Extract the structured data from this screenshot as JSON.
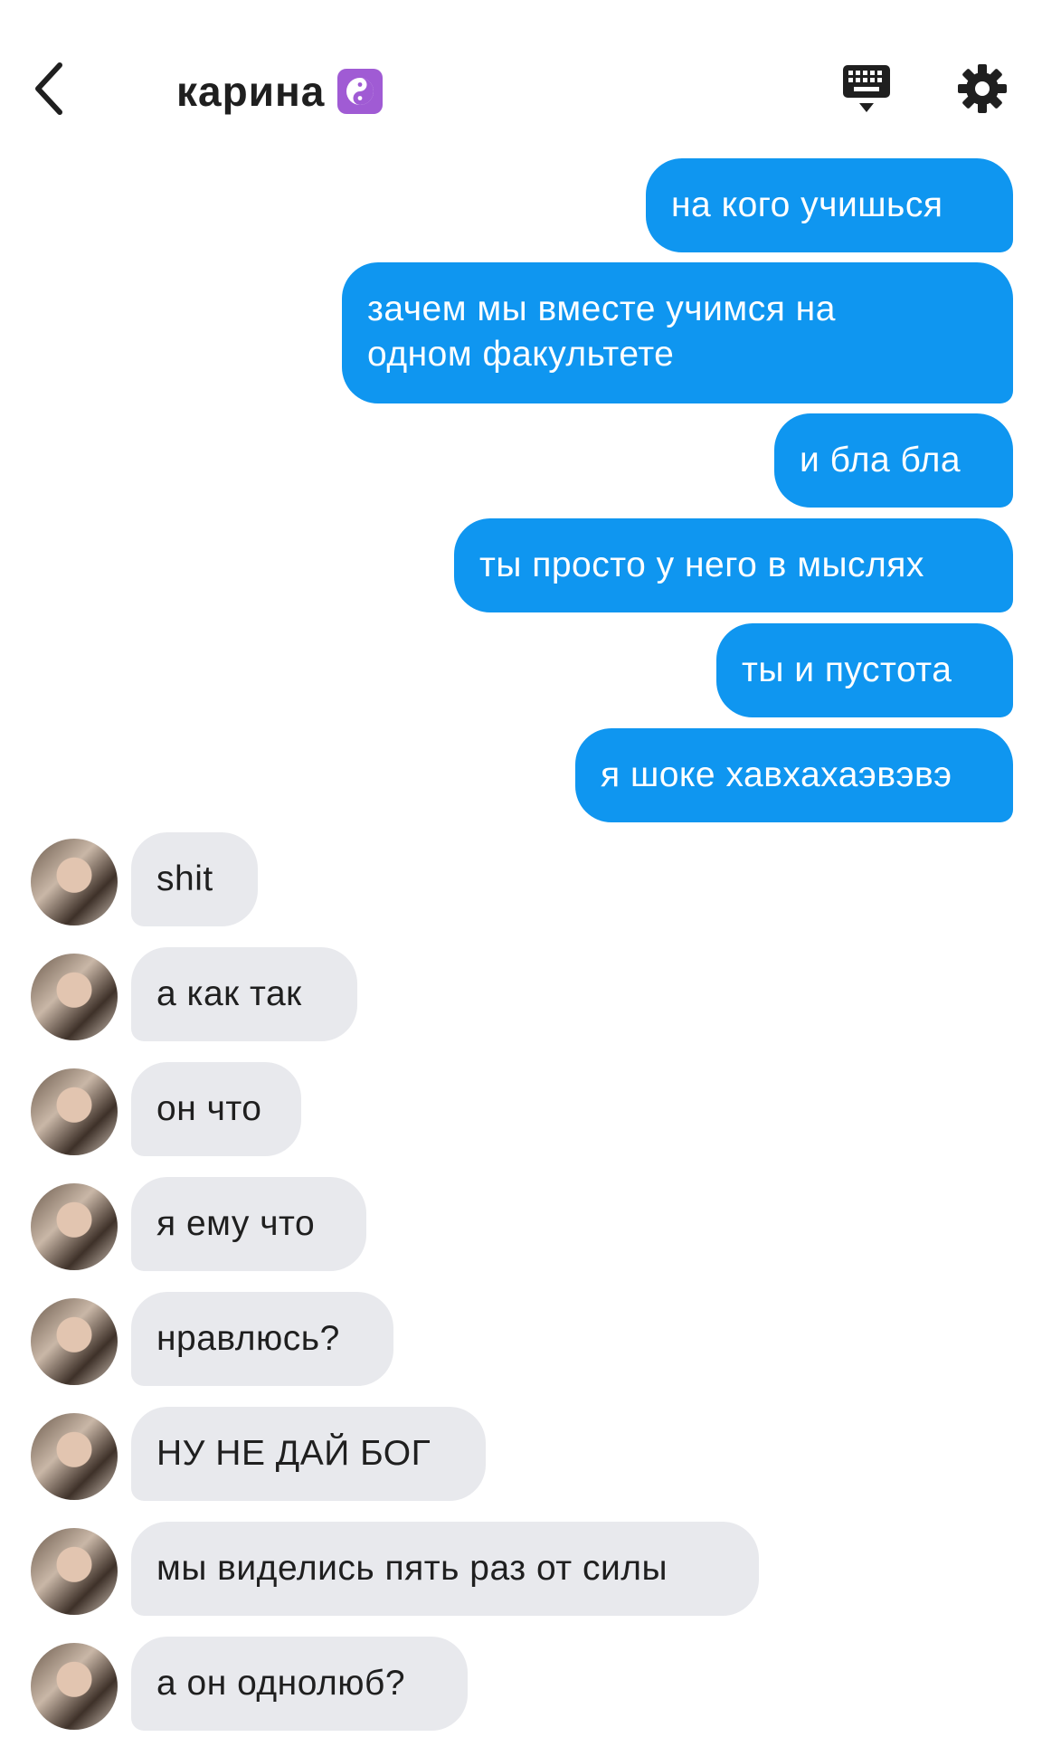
{
  "header": {
    "title": "карина",
    "title_badge_icon": "yin-yang-icon",
    "badge_color": "#a05bd4",
    "icons": [
      "back-arrow-icon",
      "keyboard-icon",
      "gear-icon"
    ]
  },
  "colors": {
    "outgoing": "#0f96f0",
    "incoming": "#e8e9ed",
    "text": "#1f1f1f"
  },
  "messages_out": [
    {
      "text": "на кого учишься"
    },
    {
      "text": "зачем мы вместе учимся на\nодном факультете"
    },
    {
      "text": "и бла бла"
    },
    {
      "text": "ты просто у него в мыслях"
    },
    {
      "text": "ты и пустота"
    },
    {
      "text": "я шоке хавхахаэвэвэ"
    }
  ],
  "messages_in": [
    {
      "text": "shit"
    },
    {
      "text": "а как так"
    },
    {
      "text": "он что"
    },
    {
      "text": "я ему что"
    },
    {
      "text": "нравлюсь?"
    },
    {
      "text": "НУ НЕ ДАЙ БОГ"
    },
    {
      "text": "мы виделись пять раз от силы"
    },
    {
      "text": "а он однолюб?"
    }
  ]
}
